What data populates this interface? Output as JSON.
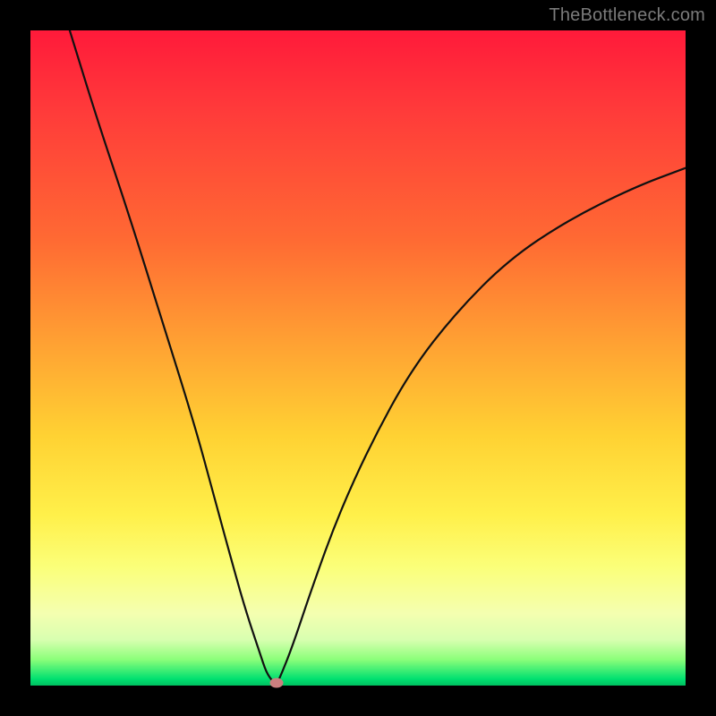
{
  "watermark": "TheBottleneck.com",
  "chart_data": {
    "type": "line",
    "title": "",
    "xlabel": "",
    "ylabel": "",
    "xlim": [
      0,
      100
    ],
    "ylim": [
      0,
      100
    ],
    "series": [
      {
        "name": "bottleneck-curve",
        "x": [
          6,
          10,
          15,
          20,
          25,
          28,
          31,
          33,
          35,
          36,
          37,
          37.5,
          38,
          40,
          43,
          47,
          52,
          58,
          65,
          73,
          82,
          92,
          100
        ],
        "values": [
          100,
          87,
          72,
          56,
          40,
          29,
          18,
          11,
          5,
          2,
          0.6,
          0.2,
          1,
          6,
          15,
          26,
          37,
          48,
          57,
          65,
          71,
          76,
          79
        ]
      }
    ],
    "marker": {
      "x": 37.5,
      "y": 0.4,
      "color": "#cc7f7f"
    },
    "gradient_stops": [
      {
        "pos": 0,
        "color": "#ff1a3a"
      },
      {
        "pos": 32,
        "color": "#ff6a33"
      },
      {
        "pos": 62,
        "color": "#ffd233"
      },
      {
        "pos": 89,
        "color": "#f4ffb0"
      },
      {
        "pos": 100,
        "color": "#00c060"
      }
    ]
  }
}
